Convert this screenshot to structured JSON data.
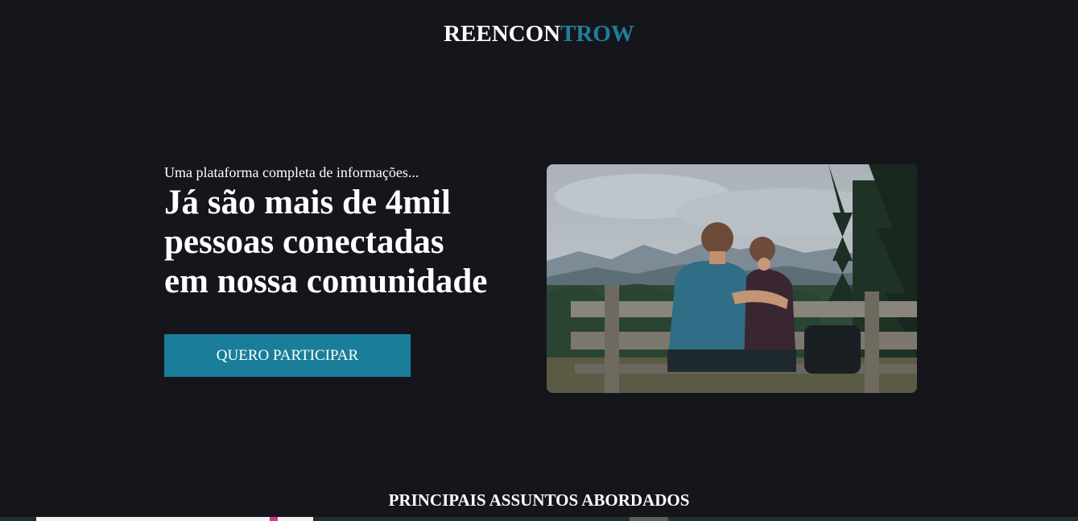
{
  "brand": {
    "part1": "REENCON",
    "part2": "TROW",
    "accent_color": "#1f7e9c"
  },
  "hero": {
    "tagline": "Uma plataforma completa de informações...",
    "headline_line1": "Já são mais de 4mil",
    "headline_line2": "pessoas conectadas",
    "headline_line3": "em nossa comunidade",
    "cta_label": "QUERO PARTICIPAR"
  },
  "sections": {
    "topics_title": "PRINCIPAIS ASSUNTOS ABORDADOS"
  },
  "colors": {
    "background": "#15161b",
    "button": "#1a7d9a"
  }
}
